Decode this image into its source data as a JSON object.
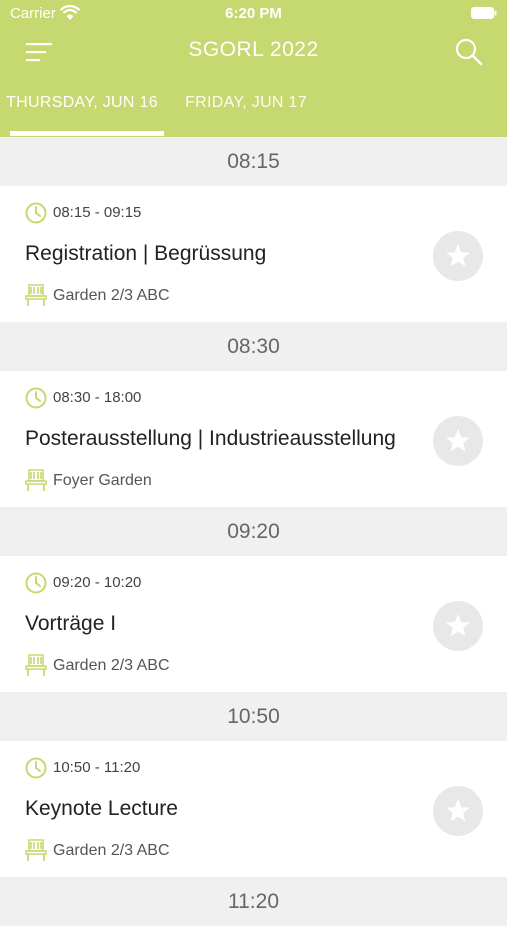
{
  "status_bar": {
    "carrier": "Carrier",
    "time": "6:20 PM"
  },
  "nav": {
    "title": "SGORL 2022"
  },
  "tabs": [
    {
      "label": "THURSDAY, JUN 16",
      "selected": true
    },
    {
      "label": "FRIDAY, JUN 17",
      "selected": false
    }
  ],
  "time_headers": [
    "08:15",
    "08:30",
    "09:20",
    "10:50",
    "11:20"
  ],
  "sessions": [
    {
      "time": "08:15 - 09:15",
      "title": "Registration | Begrüssung",
      "location": "Garden 2/3 ABC"
    },
    {
      "time": "08:30 - 18:00",
      "title": "Posterausstellung | Industrieausstellung",
      "location": "Foyer Garden"
    },
    {
      "time": "09:20 - 10:20",
      "title": "Vorträge I",
      "location": "Garden 2/3 ABC"
    },
    {
      "time": "10:50 - 11:20",
      "title": "Keynote Lecture",
      "location": "Garden 2/3 ABC"
    }
  ],
  "colors": {
    "accent": "#c6d870",
    "background": "#f0f0f0",
    "star_button": "#e8e8e8"
  }
}
